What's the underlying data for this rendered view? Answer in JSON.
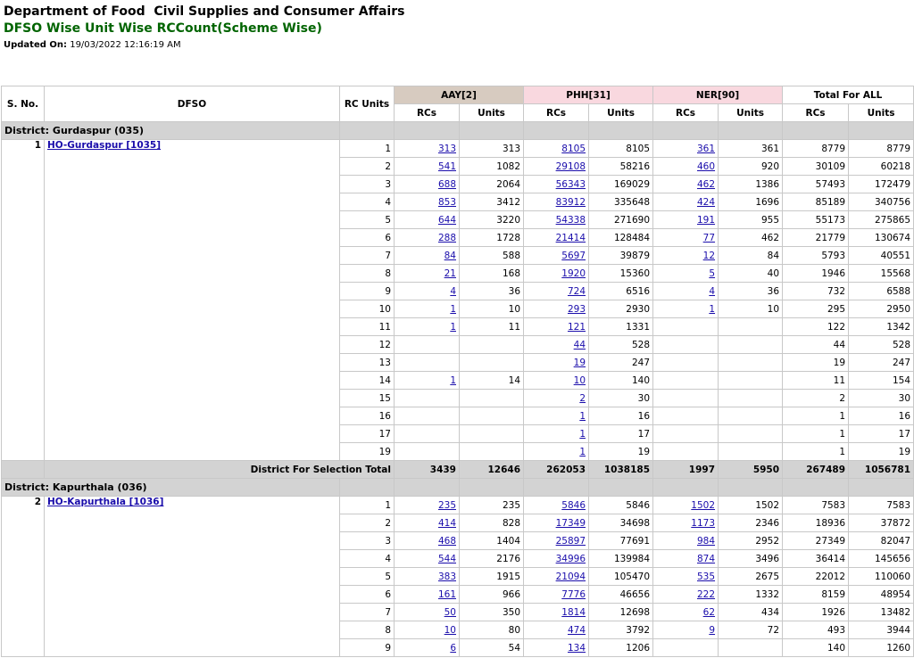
{
  "header": {
    "title": "Department of Food  Civil Supplies and Consumer Affairs",
    "subtitle": "DFSO Wise Unit Wise RCCount(Scheme Wise)",
    "updated_label": "Updated On:",
    "updated_value": "19/03/2022 12:16:19 AM"
  },
  "table": {
    "col_sno": "S. No.",
    "col_dfso": "DFSO",
    "col_rcunits": "RC Units",
    "groups": [
      "AAY[2]",
      "PHH[31]",
      "NER[90]",
      "Total For ALL"
    ],
    "sub_rcs": "RCs",
    "sub_units": "Units",
    "districts": [
      {
        "name": "District: Gurdaspur (035)",
        "sno": "1",
        "dfso": "HO-Gurdaspur [1035]",
        "rows": [
          [
            "1",
            "313",
            "313",
            "8105",
            "8105",
            "361",
            "361",
            "8779",
            "8779"
          ],
          [
            "2",
            "541",
            "1082",
            "29108",
            "58216",
            "460",
            "920",
            "30109",
            "60218"
          ],
          [
            "3",
            "688",
            "2064",
            "56343",
            "169029",
            "462",
            "1386",
            "57493",
            "172479"
          ],
          [
            "4",
            "853",
            "3412",
            "83912",
            "335648",
            "424",
            "1696",
            "85189",
            "340756"
          ],
          [
            "5",
            "644",
            "3220",
            "54338",
            "271690",
            "191",
            "955",
            "55173",
            "275865"
          ],
          [
            "6",
            "288",
            "1728",
            "21414",
            "128484",
            "77",
            "462",
            "21779",
            "130674"
          ],
          [
            "7",
            "84",
            "588",
            "5697",
            "39879",
            "12",
            "84",
            "5793",
            "40551"
          ],
          [
            "8",
            "21",
            "168",
            "1920",
            "15360",
            "5",
            "40",
            "1946",
            "15568"
          ],
          [
            "9",
            "4",
            "36",
            "724",
            "6516",
            "4",
            "36",
            "732",
            "6588"
          ],
          [
            "10",
            "1",
            "10",
            "293",
            "2930",
            "1",
            "10",
            "295",
            "2950"
          ],
          [
            "11",
            "1",
            "11",
            "121",
            "1331",
            "",
            "",
            "122",
            "1342"
          ],
          [
            "12",
            "",
            "",
            "44",
            "528",
            "",
            "",
            "44",
            "528"
          ],
          [
            "13",
            "",
            "",
            "19",
            "247",
            "",
            "",
            "19",
            "247"
          ],
          [
            "14",
            "1",
            "14",
            "10",
            "140",
            "",
            "",
            "11",
            "154"
          ],
          [
            "15",
            "",
            "",
            "2",
            "30",
            "",
            "",
            "2",
            "30"
          ],
          [
            "16",
            "",
            "",
            "1",
            "16",
            "",
            "",
            "1",
            "16"
          ],
          [
            "17",
            "",
            "",
            "1",
            "17",
            "",
            "",
            "1",
            "17"
          ],
          [
            "19",
            "",
            "",
            "1",
            "19",
            "",
            "",
            "1",
            "19"
          ]
        ],
        "total_label": "District For Selection Total",
        "total": [
          "3439",
          "12646",
          "262053",
          "1038185",
          "1997",
          "5950",
          "267489",
          "1056781"
        ]
      },
      {
        "name": "District: Kapurthala (036)",
        "sno": "2",
        "dfso": "HO-Kapurthala [1036]",
        "rows": [
          [
            "1",
            "235",
            "235",
            "5846",
            "5846",
            "1502",
            "1502",
            "7583",
            "7583"
          ],
          [
            "2",
            "414",
            "828",
            "17349",
            "34698",
            "1173",
            "2346",
            "18936",
            "37872"
          ],
          [
            "3",
            "468",
            "1404",
            "25897",
            "77691",
            "984",
            "2952",
            "27349",
            "82047"
          ],
          [
            "4",
            "544",
            "2176",
            "34996",
            "139984",
            "874",
            "3496",
            "36414",
            "145656"
          ],
          [
            "5",
            "383",
            "1915",
            "21094",
            "105470",
            "535",
            "2675",
            "22012",
            "110060"
          ],
          [
            "6",
            "161",
            "966",
            "7776",
            "46656",
            "222",
            "1332",
            "8159",
            "48954"
          ],
          [
            "7",
            "50",
            "350",
            "1814",
            "12698",
            "62",
            "434",
            "1926",
            "13482"
          ],
          [
            "8",
            "10",
            "80",
            "474",
            "3792",
            "9",
            "72",
            "493",
            "3944"
          ],
          [
            "9",
            "6",
            "54",
            "134",
            "1206",
            "",
            "",
            "140",
            "1260"
          ]
        ]
      }
    ]
  }
}
